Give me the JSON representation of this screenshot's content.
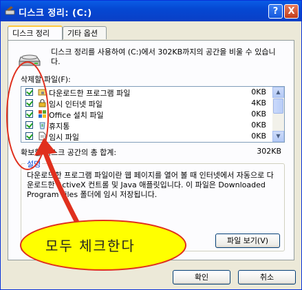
{
  "window": {
    "title": "디스크 정리: (C:)",
    "help_label": "?",
    "close_label": "X"
  },
  "tabs": [
    {
      "label": "디스크 정리",
      "active": true
    },
    {
      "label": "기타 옵션",
      "active": false
    }
  ],
  "description": "디스크 정리를 사용하여 (C:)에서 302KB까지의 공간을 비울 수 있습니다.",
  "files_label": "삭제할 파일(F):",
  "files": [
    {
      "name": "다운로드한 프로그램 파일",
      "size": "0KB",
      "checked": true
    },
    {
      "name": "임시 인터넷 파일",
      "size": "4KB",
      "checked": true
    },
    {
      "name": "Office 설치 파일",
      "size": "0KB",
      "checked": true
    },
    {
      "name": "휴지통",
      "size": "0KB",
      "checked": true
    },
    {
      "name": "임시 파일",
      "size": "0KB",
      "checked": true
    }
  ],
  "total": {
    "label": "확보할 디스크 공간의 총 합계:",
    "value": "302KB"
  },
  "group": {
    "title": "설명",
    "text": "다운로드한 프로그램 파일이란 웹 페이지를 열어 볼 때 인터넷에서 자동으로 다운로드한 ActiveX 컨트롤 및 Java 애플릿입니다. 이 파일은 Downloaded Program Files 폴더에 임시 저장됩니다.",
    "view_button": "파일 보기(V)"
  },
  "buttons": {
    "ok": "확인",
    "cancel": "취소"
  },
  "annotation": {
    "text": "모두 체크한다",
    "ellipse_fill": "#ffff00",
    "ellipse_stroke": "#e0301e",
    "arrow_color": "#e0301e"
  }
}
